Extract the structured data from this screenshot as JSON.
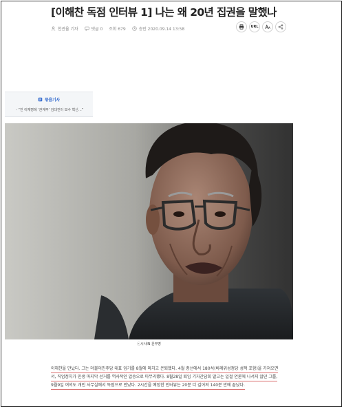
{
  "article": {
    "headline": "[이해찬 독점 인터뷰 1] 나는 왜 20년 집권을 말했나",
    "author": "천관율 기자",
    "comments": "댓글 0",
    "views": "조회 679",
    "published": "승인 2020.09.14 13:58"
  },
  "actions": {
    "print_label": "인쇄",
    "url_label": "URL",
    "font_label": "가",
    "share_label": "공유"
  },
  "related": {
    "title": "묶음기사",
    "items": [
      "“친 이재명에 ‘관계부’ 김대진이 보수 혁신…”"
    ]
  },
  "photo": {
    "caption": "ⓒ시사IN 윤무영"
  },
  "body": {
    "lines": [
      "이해찬을 만났다. 그는 더불어민주당 대표 임기를 8월에 마치고 은퇴했다. 4월 총선에서 180석(비례위성정당 성적 포함)을 가져오면",
      "서, 직업정치가 인생 마지막 선거를 역사적인 압승으로 마무리했다. 8월28일 퇴임 기자간담회 말고는 일절 언론에 나서지 않던 그를,",
      "9월9일 여의도 개인 사무실에서 독점으로 만났다. 2시간을 예정한 인터뷰는 20분 더 길어져 140분 만에 끝났다."
    ]
  }
}
